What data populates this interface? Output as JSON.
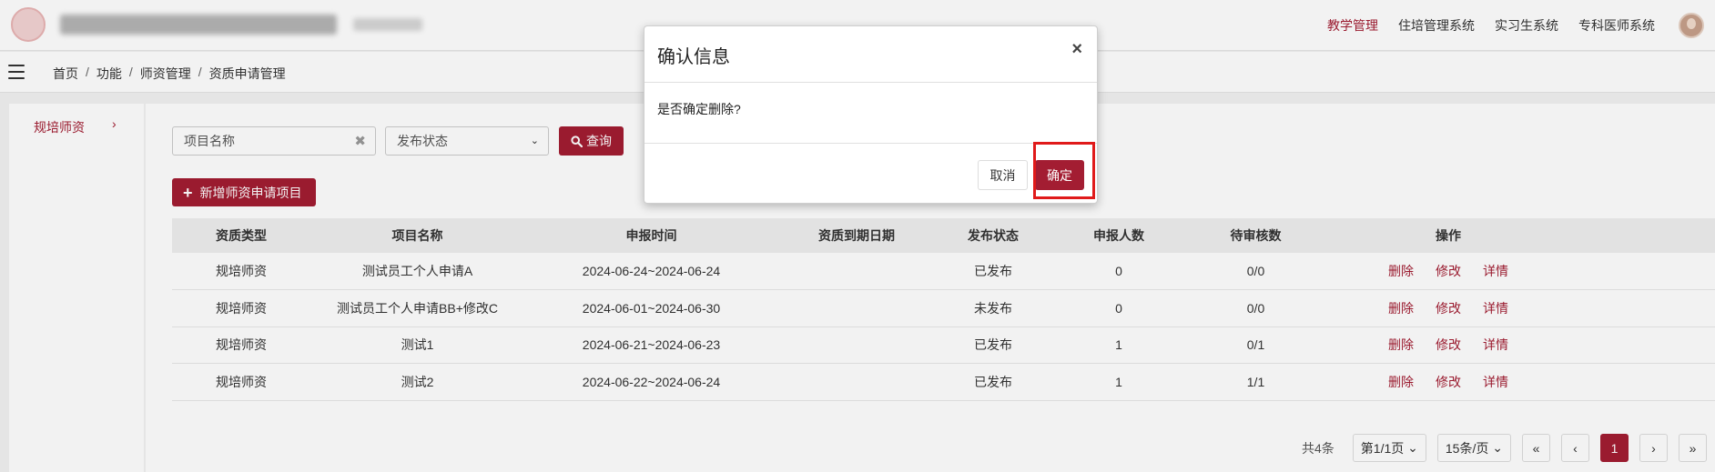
{
  "topnav": {
    "items": [
      "教学管理",
      "住培管理系统",
      "实习生系统",
      "专科医师系统"
    ],
    "active_index": 0
  },
  "breadcrumb": [
    "首页",
    "功能",
    "师资管理",
    "资质申请管理"
  ],
  "breadcrumb_sep": "/",
  "sidebar": {
    "items": [
      {
        "label": "规培师资",
        "arrow": "›"
      }
    ]
  },
  "filters": {
    "name_placeholder": "项目名称",
    "clear": "✖",
    "status_placeholder": "发布状态",
    "caret": "⌄",
    "query_label": "查询",
    "query_icon": "🔍"
  },
  "add_button": {
    "icon": "+",
    "label": "新增师资申请项目"
  },
  "table": {
    "headers": [
      "资质类型",
      "项目名称",
      "申报时间",
      "资质到期日期",
      "发布状态",
      "申报人数",
      "待审核数",
      "操作"
    ],
    "rows": [
      {
        "type": "规培师资",
        "name": "测试员工个人申请A",
        "period": "2024-06-24~2024-06-24",
        "expiry": "",
        "status": "已发布",
        "applicants": "0",
        "pending": "0/0"
      },
      {
        "type": "规培师资",
        "name": "测试员工个人申请BB+修改C",
        "period": "2024-06-01~2024-06-30",
        "expiry": "",
        "status": "未发布",
        "applicants": "0",
        "pending": "0/0"
      },
      {
        "type": "规培师资",
        "name": "测试1",
        "period": "2024-06-21~2024-06-23",
        "expiry": "",
        "status": "已发布",
        "applicants": "1",
        "pending": "0/1"
      },
      {
        "type": "规培师资",
        "name": "测试2",
        "period": "2024-06-22~2024-06-24",
        "expiry": "",
        "status": "已发布",
        "applicants": "1",
        "pending": "1/1"
      }
    ],
    "actions": [
      "删除",
      "修改",
      "详情"
    ]
  },
  "pagination": {
    "total": "共4条",
    "page_info": "第1/1页",
    "page_size": "15条/页",
    "caret": "⌄",
    "first": "«",
    "prev": "‹",
    "current": "1",
    "next": "›",
    "last": "»"
  },
  "modal": {
    "title": "确认信息",
    "close": "×",
    "message": "是否确定删除?",
    "cancel_label": "取消",
    "ok_label": "确定"
  },
  "colors": {
    "accent": "#a31d32",
    "highlight": "#e01a1a"
  }
}
